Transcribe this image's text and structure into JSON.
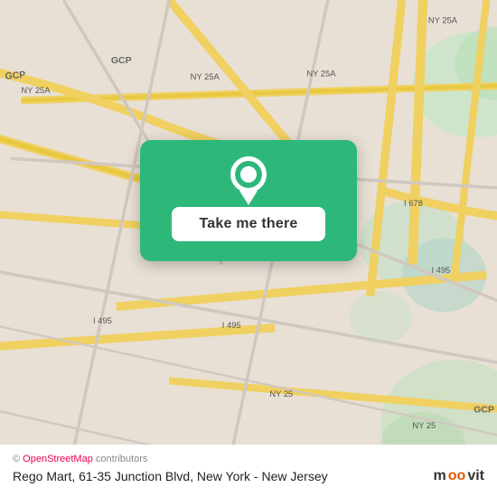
{
  "map": {
    "button": {
      "label": "Take me there"
    },
    "copyright": "© OpenStreetMap contributors",
    "location_text": "Rego Mart, 61-35 Junction Blvd, New York - New Jersey",
    "moovit_label": "moovit",
    "colors": {
      "green": "#2db87a",
      "dark_green": "#1a9e64"
    }
  }
}
